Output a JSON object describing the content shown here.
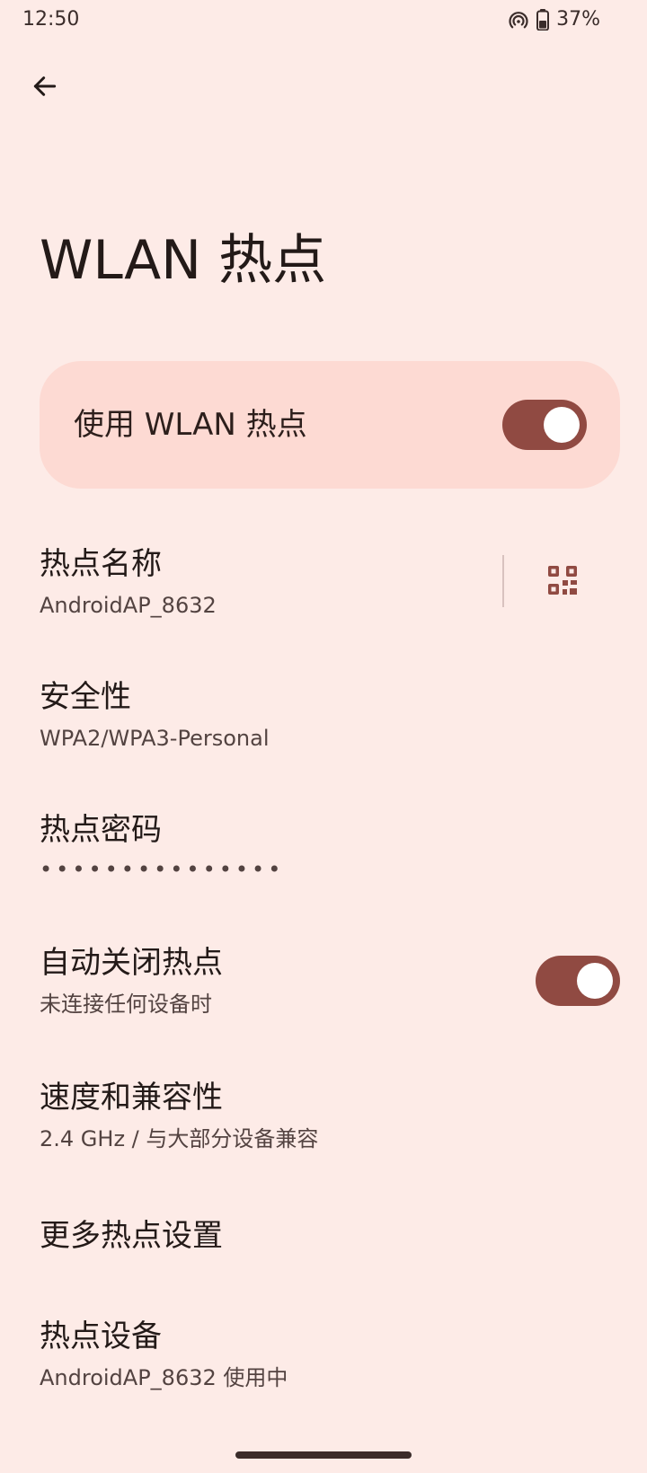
{
  "status_bar": {
    "time": "12:50",
    "battery_percent": "37%",
    "icons": [
      "hotspot-icon",
      "battery-icon"
    ]
  },
  "header": {
    "back_icon": "arrow-back-icon",
    "title": "WLAN 热点"
  },
  "master_toggle": {
    "label": "使用 WLAN 热点",
    "checked": true
  },
  "items": [
    {
      "title": "热点名称",
      "subtitle": "AndroidAP_8632",
      "icon": "qr-code-icon"
    },
    {
      "title": "安全性",
      "subtitle": "WPA2/WPA3-Personal"
    },
    {
      "title": "热点密码",
      "subtitle": "•••••••••••••••"
    },
    {
      "title": "自动关闭热点",
      "subtitle": "未连接任何设备时",
      "checked": true
    },
    {
      "title": "速度和兼容性",
      "subtitle": "2.4 GHz / 与大部分设备兼容"
    },
    {
      "title": "更多热点设置",
      "subtitle": ""
    },
    {
      "title": "热点设备",
      "subtitle": "AndroidAP_8632 使用中"
    }
  ],
  "colors": {
    "background": "#fdebe7",
    "card": "#fddad3",
    "accent": "#904a42",
    "text_primary": "#231a18",
    "text_secondary": "#534341"
  }
}
